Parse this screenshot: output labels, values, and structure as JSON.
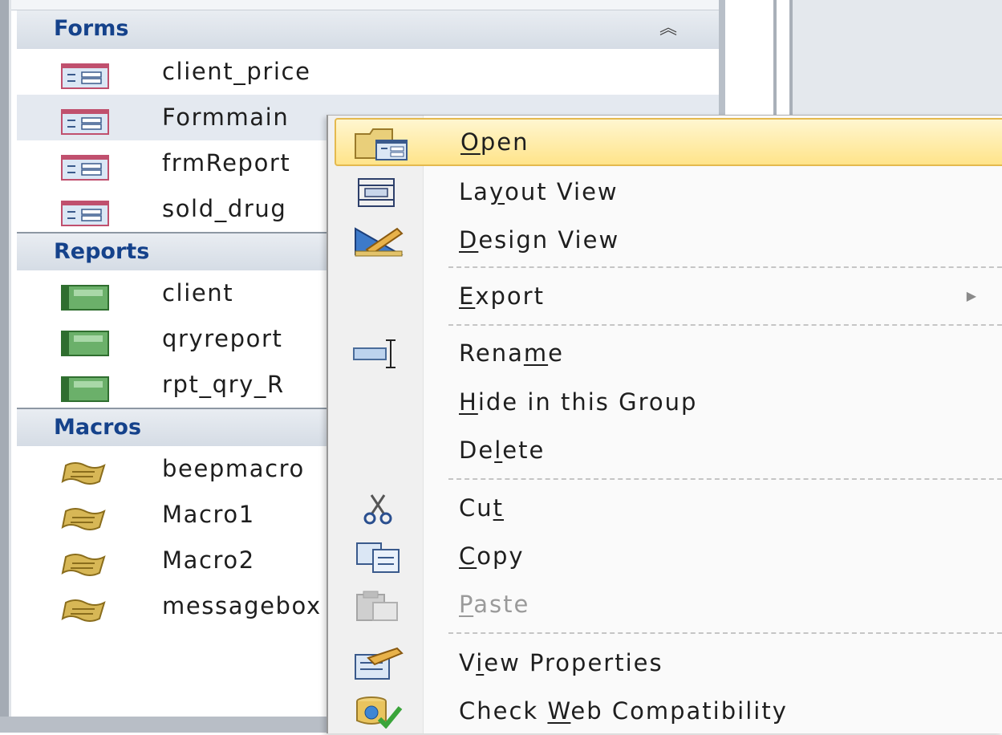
{
  "nav_pane": {
    "groups": [
      {
        "title": "Forms",
        "items": [
          {
            "label": "client_price",
            "type": "form"
          },
          {
            "label": "Formmain",
            "type": "form",
            "selected": true
          },
          {
            "label": "frmReport",
            "type": "form"
          },
          {
            "label": "sold_drug",
            "type": "form"
          }
        ]
      },
      {
        "title": "Reports",
        "items": [
          {
            "label": "client",
            "type": "report"
          },
          {
            "label": "qryreport",
            "type": "report"
          },
          {
            "label": "rpt_qry_R",
            "type": "report"
          }
        ]
      },
      {
        "title": "Macros",
        "items": [
          {
            "label": "beepmacro",
            "type": "macro"
          },
          {
            "label": "Macro1",
            "type": "macro"
          },
          {
            "label": "Macro2",
            "type": "macro"
          },
          {
            "label": "messagebox",
            "type": "macro"
          }
        ]
      }
    ],
    "collapse_icon": "double-chevron-up-icon"
  },
  "context_menu": {
    "items": [
      {
        "id": "open",
        "pre": "",
        "key": "O",
        "post": "pen",
        "icon": "open-form-icon",
        "highlighted": true
      },
      {
        "id": "layout-view",
        "pre": "La",
        "key": "y",
        "post": "out View",
        "icon": "layout-view-icon"
      },
      {
        "id": "design-view",
        "pre": "",
        "key": "D",
        "post": "esign View",
        "icon": "design-view-icon"
      },
      {
        "id": "export",
        "pre": "",
        "key": "E",
        "post": "xport",
        "icon": "",
        "submenu": true
      },
      {
        "id": "rename",
        "pre": "Rena",
        "key": "m",
        "post": "e",
        "icon": "rename-icon"
      },
      {
        "id": "hide-in-group",
        "pre": "",
        "key": "H",
        "post": "ide in this Group",
        "icon": ""
      },
      {
        "id": "delete",
        "pre": "De",
        "key": "l",
        "post": "ete",
        "icon": ""
      },
      {
        "id": "cut",
        "pre": "Cu",
        "key": "t",
        "post": "",
        "icon": "scissors-icon"
      },
      {
        "id": "copy",
        "pre": "",
        "key": "C",
        "post": "opy",
        "icon": "copy-icon"
      },
      {
        "id": "paste",
        "pre": "",
        "key": "P",
        "post": "aste",
        "icon": "paste-icon",
        "disabled": true
      },
      {
        "id": "view-properties",
        "pre": "V",
        "key": "i",
        "post": "ew Properties",
        "icon": "properties-icon"
      },
      {
        "id": "check-web-compat",
        "pre": "Check ",
        "key": "W",
        "post": "eb Compatibility",
        "icon": "web-compatibility-icon"
      }
    ],
    "colors": {
      "highlight_top": "#fff6d0",
      "highlight_bottom": "#ffe48a",
      "highlight_border": "#e4b94e",
      "group_header_text": "#15428b"
    }
  }
}
